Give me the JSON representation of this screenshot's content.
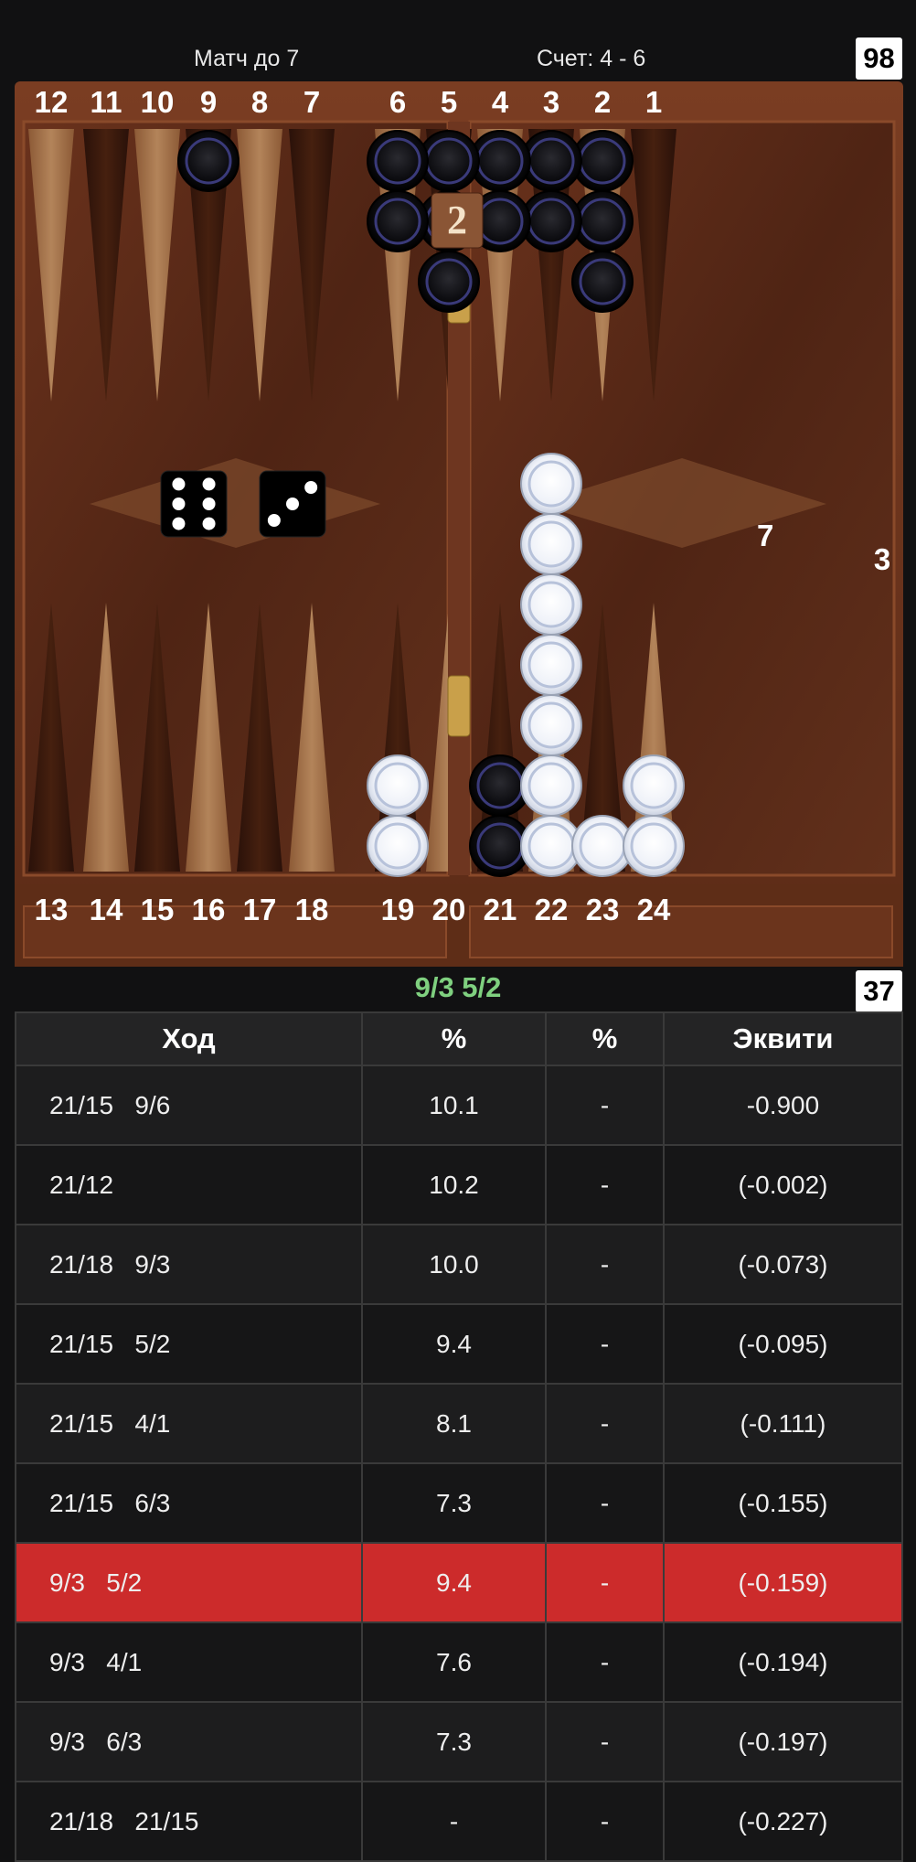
{
  "header": {
    "match_label": "Матч до 7",
    "score_label": "Счет: 4 - 6",
    "pip_top": "98",
    "pip_bottom": "37"
  },
  "board": {
    "top_numbers": [
      "12",
      "11",
      "10",
      "9",
      "8",
      "7",
      "6",
      "5",
      "4",
      "3",
      "2",
      "1"
    ],
    "bottom_numbers": [
      "13",
      "14",
      "15",
      "16",
      "17",
      "18",
      "19",
      "20",
      "21",
      "22",
      "23",
      "24"
    ],
    "cube_value": "2",
    "dice": [
      6,
      3
    ],
    "stack_label": "7",
    "borne_off_count": "3",
    "black_checkers": {
      "9": 1,
      "6": 2,
      "5": 3,
      "4": 2,
      "3": 2,
      "2": 3,
      "21": 2
    },
    "white_checkers": {
      "19": 2,
      "22": 7,
      "23": 1,
      "24": 2
    },
    "colors": {
      "wood": "#5a2c18",
      "frame": "#6e3620",
      "black_checker": "#0f0f12",
      "white_checker": "#f0f3fa"
    }
  },
  "last_move": "9/3 5/2",
  "table": {
    "headers": [
      "Ход",
      "%",
      "%",
      "Эквити"
    ],
    "rows": [
      {
        "move": "21/15   9/6",
        "p1": "10.1",
        "p2": "-",
        "eq": "-0.900",
        "selected": false
      },
      {
        "move": "21/12",
        "p1": "10.2",
        "p2": "-",
        "eq": "(-0.002)",
        "selected": false
      },
      {
        "move": "21/18   9/3",
        "p1": "10.0",
        "p2": "-",
        "eq": "(-0.073)",
        "selected": false
      },
      {
        "move": "21/15   5/2",
        "p1": "9.4",
        "p2": "-",
        "eq": "(-0.095)",
        "selected": false
      },
      {
        "move": "21/15   4/1",
        "p1": "8.1",
        "p2": "-",
        "eq": "(-0.111)",
        "selected": false
      },
      {
        "move": "21/15   6/3",
        "p1": "7.3",
        "p2": "-",
        "eq": "(-0.155)",
        "selected": false
      },
      {
        "move": "9/3   5/2",
        "p1": "9.4",
        "p2": "-",
        "eq": "(-0.159)",
        "selected": true
      },
      {
        "move": "9/3   4/1",
        "p1": "7.6",
        "p2": "-",
        "eq": "(-0.194)",
        "selected": false
      },
      {
        "move": "9/3   6/3",
        "p1": "7.3",
        "p2": "-",
        "eq": "(-0.197)",
        "selected": false
      },
      {
        "move": "21/18   21/15",
        "p1": "-",
        "p2": "-",
        "eq": "(-0.227)",
        "selected": false
      }
    ]
  }
}
